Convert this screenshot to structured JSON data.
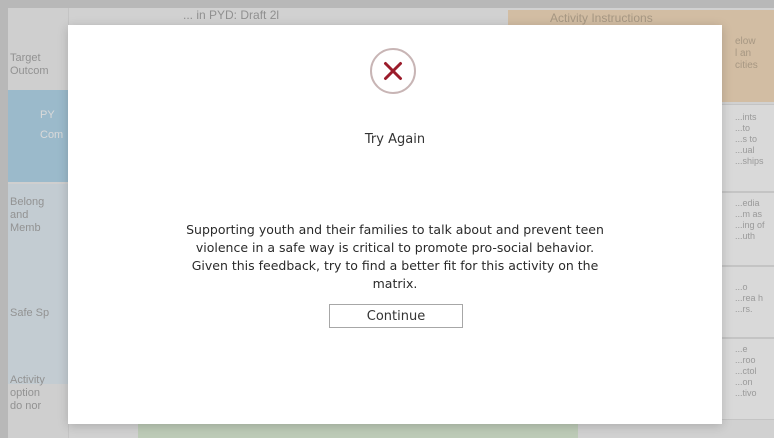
{
  "background": {
    "title": "... in PYD: Draft 2l",
    "instructions_title": "Activity Instructions",
    "left_labels": [
      "Target\nOutcom",
      "Belong\nand\nMemb",
      "Safe Sp",
      "Activity\noption\ndo nor"
    ],
    "left_blue_text": [
      "PY",
      "Com"
    ],
    "right_notes": [
      "elow\nl an\ncities"
    ],
    "right_card_texts": [
      "...ints\n...to\n...s to\n...ual\n...ships",
      "...edia\n...m as\n...ing of\n...uth",
      "...o\n...rea h\n...rs.",
      "...e\n...roo\n...ctol\n...on\n...tivo"
    ]
  },
  "modal": {
    "icon": "close-x-icon",
    "icon_color": "#9b1c2b",
    "title": "Try Again",
    "message": "Supporting youth and their families to talk about and prevent teen violence in a safe way is critical to promote pro-social behavior. Given this feedback, try to find a better fit for this activity on the matrix.",
    "continue_label": "Continue"
  }
}
